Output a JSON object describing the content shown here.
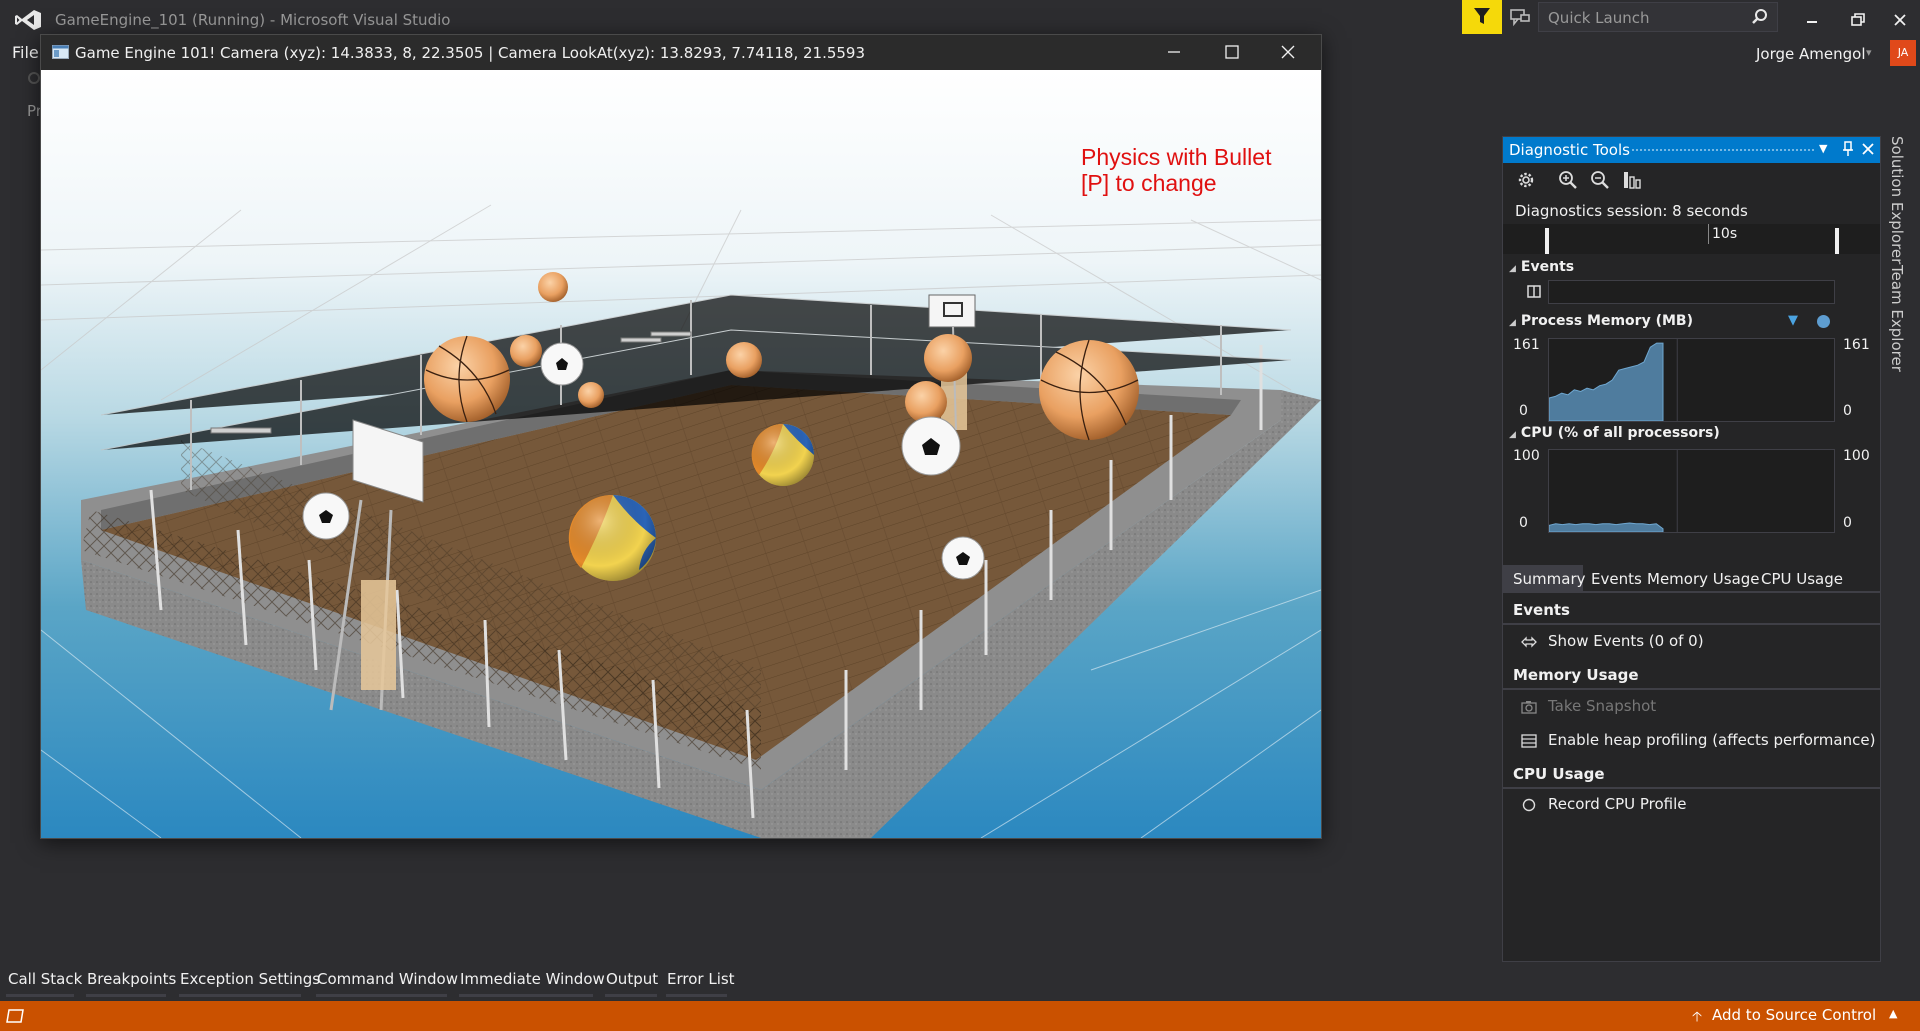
{
  "app": {
    "window_title": "GameEngine_101 (Running) - Microsoft Visual Studio",
    "quick_launch_placeholder": "Quick Launch",
    "user_name": "Jorge Amengol",
    "user_initials": "JA",
    "menu_file": "File",
    "menu_partial": "Pr"
  },
  "game": {
    "title": "Game Engine 101! Camera (xyz): 14.3833, 8, 22.3505 | Camera LookAt(xyz): 13.8293, 7.74118, 21.5593",
    "overlay_line1": "Physics with Bullet",
    "overlay_line2": "[P] to change"
  },
  "diagnostics": {
    "title": "Diagnostic Tools",
    "session": "Diagnostics session: 8 seconds",
    "timeline_label": "10s",
    "events_header": "Events",
    "memory_header": "Process Memory (MB)",
    "memory_max": "161",
    "memory_min": "0",
    "memory_series": [
      0.28,
      0.3,
      0.34,
      0.32,
      0.38,
      0.36,
      0.4,
      0.38,
      0.43,
      0.45,
      0.5,
      0.62,
      0.64,
      0.66,
      0.68,
      0.72,
      0.9,
      0.95,
      0.95
    ],
    "cpu_header": "CPU (% of all processors)",
    "cpu_max": "100",
    "cpu_min": "0",
    "cpu_series": [
      0.08,
      0.1,
      0.09,
      0.1,
      0.09,
      0.1,
      0.1,
      0.09,
      0.1,
      0.1,
      0.09,
      0.1,
      0.11,
      0.1,
      0.1,
      0.09,
      0.1,
      0.04
    ],
    "tabs": [
      "Summary",
      "Events",
      "Memory Usage",
      "CPU Usage"
    ],
    "summary": {
      "events_head": "Events",
      "show_events": "Show Events (0 of 0)",
      "memory_head": "Memory Usage",
      "take_snapshot": "Take Snapshot",
      "heap_profiling": "Enable heap profiling (affects performance)",
      "cpu_head": "CPU Usage",
      "record_cpu": "Record CPU Profile"
    },
    "accent": "#007acc"
  },
  "side_tabs": [
    "Solution Explorer",
    "Team Explorer"
  ],
  "bottom_tabs": [
    "Call Stack",
    "Breakpoints",
    "Exception Settings",
    "Command Window",
    "Immediate Window",
    "Output",
    "Error List"
  ],
  "status": {
    "source_control": "Add to Source Control",
    "color": "#ca5100"
  }
}
